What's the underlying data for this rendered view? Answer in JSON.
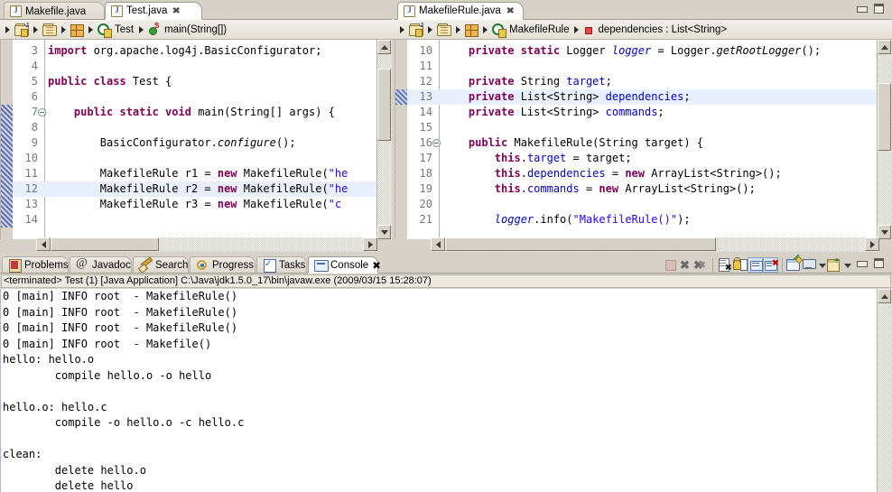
{
  "window": {
    "minimize_label": "Minimize",
    "maximize_label": "Maximize"
  },
  "left_editor": {
    "tabs": [
      {
        "label": "Makefile.java",
        "active": false,
        "closable": false,
        "icon": "java-file-icon"
      },
      {
        "label": "Test.java",
        "active": true,
        "closable": true,
        "icon": "java-file-icon"
      }
    ],
    "breadcrumb": [
      {
        "icon": "package-root-icon",
        "label": ""
      },
      {
        "icon": "package-icon",
        "label": ""
      },
      {
        "icon": "compilation-unit-icon",
        "label": ""
      },
      {
        "icon": "class-icon",
        "label": "Test"
      },
      {
        "icon": "method-static-icon",
        "label": "main(String[])"
      }
    ],
    "lines": [
      {
        "num": "3",
        "fold": false,
        "dirty": false,
        "hl": false,
        "tokens": [
          {
            "t": "import ",
            "c": "kw"
          },
          {
            "t": "org.apache.log4j.BasicConfigurator;",
            "c": "plain"
          }
        ]
      },
      {
        "num": "4",
        "fold": false,
        "dirty": false,
        "hl": false,
        "tokens": []
      },
      {
        "num": "5",
        "fold": false,
        "dirty": false,
        "hl": false,
        "tokens": [
          {
            "t": "public class ",
            "c": "kw"
          },
          {
            "t": "Test {",
            "c": "plain"
          }
        ]
      },
      {
        "num": "6",
        "fold": false,
        "dirty": false,
        "hl": false,
        "tokens": []
      },
      {
        "num": "7",
        "fold": true,
        "dirty": true,
        "hl": false,
        "tokens": [
          {
            "t": "    ",
            "c": "plain"
          },
          {
            "t": "public static void ",
            "c": "kw"
          },
          {
            "t": "main(String[] args) {",
            "c": "plain"
          }
        ]
      },
      {
        "num": "8",
        "fold": false,
        "dirty": true,
        "hl": false,
        "tokens": []
      },
      {
        "num": "9",
        "fold": false,
        "dirty": true,
        "hl": false,
        "tokens": [
          {
            "t": "        BasicConfigurator.",
            "c": "plain"
          },
          {
            "t": "configure",
            "c": "mtd"
          },
          {
            "t": "();",
            "c": "plain"
          }
        ]
      },
      {
        "num": "10",
        "fold": false,
        "dirty": true,
        "hl": false,
        "tokens": []
      },
      {
        "num": "11",
        "fold": false,
        "dirty": true,
        "hl": false,
        "tokens": [
          {
            "t": "        MakefileRule r1 = ",
            "c": "plain"
          },
          {
            "t": "new ",
            "c": "kw"
          },
          {
            "t": "MakefileRule(",
            "c": "plain"
          },
          {
            "t": "\"he",
            "c": "str"
          }
        ]
      },
      {
        "num": "12",
        "fold": false,
        "dirty": true,
        "hl": true,
        "tokens": [
          {
            "t": "        MakefileRule r2 = ",
            "c": "plain"
          },
          {
            "t": "new ",
            "c": "kw"
          },
          {
            "t": "MakefileRule(",
            "c": "plain"
          },
          {
            "t": "\"he",
            "c": "str"
          }
        ]
      },
      {
        "num": "13",
        "fold": false,
        "dirty": true,
        "hl": false,
        "tokens": [
          {
            "t": "        MakefileRule r3 = ",
            "c": "plain"
          },
          {
            "t": "new ",
            "c": "kw"
          },
          {
            "t": "MakefileRule(",
            "c": "plain"
          },
          {
            "t": "\"c",
            "c": "str"
          }
        ]
      },
      {
        "num": "14",
        "fold": false,
        "dirty": true,
        "hl": false,
        "tokens": []
      }
    ]
  },
  "right_editor": {
    "tabs": [
      {
        "label": "MakefileRule.java",
        "active": true,
        "closable": true,
        "icon": "java-file-icon"
      }
    ],
    "breadcrumb": [
      {
        "icon": "package-root-icon",
        "label": ""
      },
      {
        "icon": "package-icon",
        "label": ""
      },
      {
        "icon": "compilation-unit-icon",
        "label": ""
      },
      {
        "icon": "class-icon",
        "label": "MakefileRule"
      },
      {
        "icon": "field-private-icon",
        "label": "dependencies : List<String>"
      }
    ],
    "lines": [
      {
        "num": "10",
        "fold": false,
        "dirty": false,
        "hl": false,
        "tokens": [
          {
            "t": "    ",
            "c": "plain"
          },
          {
            "t": "private static ",
            "c": "kw"
          },
          {
            "t": "Logger ",
            "c": "plain"
          },
          {
            "t": "logger",
            "c": "stfld"
          },
          {
            "t": " = Logger.",
            "c": "plain"
          },
          {
            "t": "getRootLogger",
            "c": "mtd"
          },
          {
            "t": "();",
            "c": "plain"
          }
        ]
      },
      {
        "num": "11",
        "fold": false,
        "dirty": false,
        "hl": false,
        "tokens": []
      },
      {
        "num": "12",
        "fold": false,
        "dirty": false,
        "hl": false,
        "tokens": [
          {
            "t": "    ",
            "c": "plain"
          },
          {
            "t": "private ",
            "c": "kw"
          },
          {
            "t": "String ",
            "c": "plain"
          },
          {
            "t": "target",
            "c": "fld"
          },
          {
            "t": ";",
            "c": "plain"
          }
        ]
      },
      {
        "num": "13",
        "fold": false,
        "dirty": true,
        "hl": true,
        "tokens": [
          {
            "t": "    ",
            "c": "plain"
          },
          {
            "t": "private ",
            "c": "kw"
          },
          {
            "t": "List<String> ",
            "c": "plain"
          },
          {
            "t": "dependencies",
            "c": "fld"
          },
          {
            "t": ";",
            "c": "plain"
          }
        ]
      },
      {
        "num": "14",
        "fold": false,
        "dirty": false,
        "hl": false,
        "tokens": [
          {
            "t": "    ",
            "c": "plain"
          },
          {
            "t": "private ",
            "c": "kw"
          },
          {
            "t": "List<String> ",
            "c": "plain"
          },
          {
            "t": "commands",
            "c": "fld"
          },
          {
            "t": ";",
            "c": "plain"
          }
        ]
      },
      {
        "num": "15",
        "fold": false,
        "dirty": false,
        "hl": false,
        "tokens": []
      },
      {
        "num": "16",
        "fold": true,
        "dirty": false,
        "hl": false,
        "tokens": [
          {
            "t": "    ",
            "c": "plain"
          },
          {
            "t": "public ",
            "c": "kw"
          },
          {
            "t": "MakefileRule(String target) {",
            "c": "plain"
          }
        ]
      },
      {
        "num": "17",
        "fold": false,
        "dirty": false,
        "hl": false,
        "tokens": [
          {
            "t": "        ",
            "c": "plain"
          },
          {
            "t": "this",
            "c": "kw"
          },
          {
            "t": ".",
            "c": "plain"
          },
          {
            "t": "target",
            "c": "fld"
          },
          {
            "t": " = target;",
            "c": "plain"
          }
        ]
      },
      {
        "num": "18",
        "fold": false,
        "dirty": false,
        "hl": false,
        "tokens": [
          {
            "t": "        ",
            "c": "plain"
          },
          {
            "t": "this",
            "c": "kw"
          },
          {
            "t": ".",
            "c": "plain"
          },
          {
            "t": "dependencies",
            "c": "fld"
          },
          {
            "t": " = ",
            "c": "plain"
          },
          {
            "t": "new ",
            "c": "kw"
          },
          {
            "t": "ArrayList<String>();",
            "c": "plain"
          }
        ]
      },
      {
        "num": "19",
        "fold": false,
        "dirty": false,
        "hl": false,
        "tokens": [
          {
            "t": "        ",
            "c": "plain"
          },
          {
            "t": "this",
            "c": "kw"
          },
          {
            "t": ".",
            "c": "plain"
          },
          {
            "t": "commands",
            "c": "fld"
          },
          {
            "t": " = ",
            "c": "plain"
          },
          {
            "t": "new ",
            "c": "kw"
          },
          {
            "t": "ArrayList<String>();",
            "c": "plain"
          }
        ]
      },
      {
        "num": "20",
        "fold": false,
        "dirty": false,
        "hl": false,
        "tokens": []
      },
      {
        "num": "21",
        "fold": false,
        "dirty": false,
        "hl": false,
        "tokens": [
          {
            "t": "        ",
            "c": "plain"
          },
          {
            "t": "logger",
            "c": "stfld"
          },
          {
            "t": ".info(",
            "c": "plain"
          },
          {
            "t": "\"MakefileRule()\"",
            "c": "str"
          },
          {
            "t": ");",
            "c": "plain"
          }
        ]
      }
    ]
  },
  "bottom_view": {
    "tabs": [
      {
        "label": "Problems",
        "icon": "problems-icon",
        "active": false,
        "closable": false
      },
      {
        "label": "Javadoc",
        "icon": "javadoc-icon",
        "active": false,
        "closable": false
      },
      {
        "label": "Search",
        "icon": "search-icon",
        "active": false,
        "closable": false
      },
      {
        "label": "Progress",
        "icon": "progress-icon",
        "active": false,
        "closable": false
      },
      {
        "label": "Tasks",
        "icon": "tasks-icon",
        "active": false,
        "closable": false
      },
      {
        "label": "Console",
        "icon": "console-icon",
        "active": true,
        "closable": true
      }
    ],
    "toolbar": [
      {
        "name": "terminate-button",
        "icon": "stop-square-icon",
        "enabled": false
      },
      {
        "name": "remove-launch-button",
        "icon": "x-icon",
        "enabled": true
      },
      {
        "name": "remove-all-terminated-button",
        "icon": "xx-icon",
        "enabled": true
      },
      {
        "name": "clear-console-button",
        "icon": "clear-page-icon",
        "enabled": true
      },
      {
        "name": "scroll-lock-button",
        "icon": "lock-icon",
        "enabled": true
      },
      {
        "name": "pin-console-button",
        "icon": "pin-console-icon",
        "enabled": true,
        "pressed": true
      },
      {
        "name": "display-selected-console-button",
        "icon": "console-select-icon",
        "enabled": true,
        "pressed": true
      },
      {
        "name": "open-console-button",
        "icon": "new-console-icon",
        "enabled": true
      },
      {
        "name": "display-console-dropdown",
        "icon": "monitor-icon",
        "enabled": true,
        "has_dropdown": true
      },
      {
        "name": "new-console-view-dropdown",
        "icon": "new-view-icon",
        "enabled": true,
        "has_dropdown": true
      }
    ],
    "header": "<terminated> Test (1) [Java Application] C:\\Java\\jdk1.5.0_17\\bin\\javaw.exe (2009/03/15 15:28:07)",
    "output": [
      "0 [main] INFO root  - MakefileRule()",
      "0 [main] INFO root  - MakefileRule()",
      "0 [main] INFO root  - MakefileRule()",
      "0 [main] INFO root  - Makefile()",
      "hello: hello.o",
      "        compile hello.o -o hello",
      "",
      "hello.o: hello.c",
      "        compile -o hello.o -c hello.c",
      "",
      "clean:",
      "        delete hello.o",
      "        delete hello"
    ]
  },
  "colors": {
    "keyword": "#7f0055",
    "string": "#2a00ff",
    "field": "#0000c0",
    "highlight_line": "#e8f0fe",
    "chrome": "#d6d2c8",
    "tab_active": "#ffffff"
  }
}
